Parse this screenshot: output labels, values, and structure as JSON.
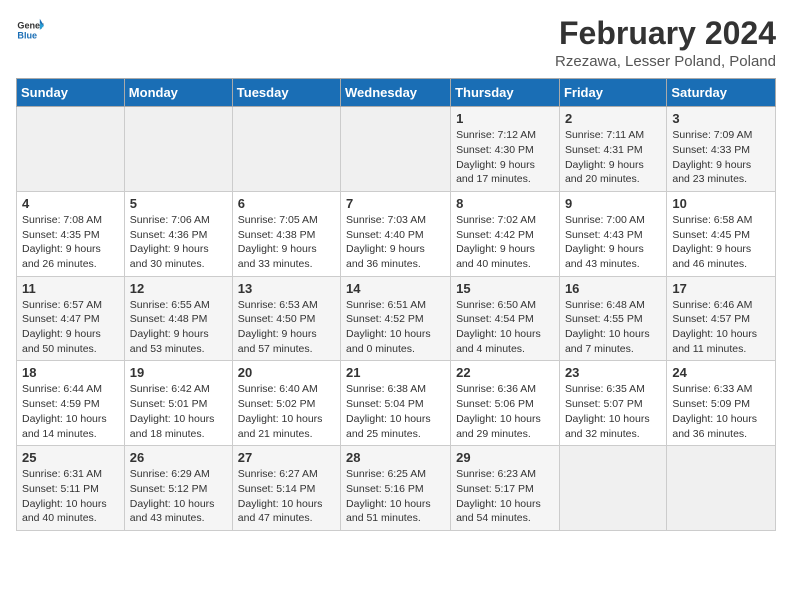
{
  "header": {
    "logo_line1": "General",
    "logo_line2": "Blue",
    "month_title": "February 2024",
    "location": "Rzezawa, Lesser Poland, Poland"
  },
  "weekdays": [
    "Sunday",
    "Monday",
    "Tuesday",
    "Wednesday",
    "Thursday",
    "Friday",
    "Saturday"
  ],
  "weeks": [
    [
      {
        "day": "",
        "info": ""
      },
      {
        "day": "",
        "info": ""
      },
      {
        "day": "",
        "info": ""
      },
      {
        "day": "",
        "info": ""
      },
      {
        "day": "1",
        "info": "Sunrise: 7:12 AM\nSunset: 4:30 PM\nDaylight: 9 hours\nand 17 minutes."
      },
      {
        "day": "2",
        "info": "Sunrise: 7:11 AM\nSunset: 4:31 PM\nDaylight: 9 hours\nand 20 minutes."
      },
      {
        "day": "3",
        "info": "Sunrise: 7:09 AM\nSunset: 4:33 PM\nDaylight: 9 hours\nand 23 minutes."
      }
    ],
    [
      {
        "day": "4",
        "info": "Sunrise: 7:08 AM\nSunset: 4:35 PM\nDaylight: 9 hours\nand 26 minutes."
      },
      {
        "day": "5",
        "info": "Sunrise: 7:06 AM\nSunset: 4:36 PM\nDaylight: 9 hours\nand 30 minutes."
      },
      {
        "day": "6",
        "info": "Sunrise: 7:05 AM\nSunset: 4:38 PM\nDaylight: 9 hours\nand 33 minutes."
      },
      {
        "day": "7",
        "info": "Sunrise: 7:03 AM\nSunset: 4:40 PM\nDaylight: 9 hours\nand 36 minutes."
      },
      {
        "day": "8",
        "info": "Sunrise: 7:02 AM\nSunset: 4:42 PM\nDaylight: 9 hours\nand 40 minutes."
      },
      {
        "day": "9",
        "info": "Sunrise: 7:00 AM\nSunset: 4:43 PM\nDaylight: 9 hours\nand 43 minutes."
      },
      {
        "day": "10",
        "info": "Sunrise: 6:58 AM\nSunset: 4:45 PM\nDaylight: 9 hours\nand 46 minutes."
      }
    ],
    [
      {
        "day": "11",
        "info": "Sunrise: 6:57 AM\nSunset: 4:47 PM\nDaylight: 9 hours\nand 50 minutes."
      },
      {
        "day": "12",
        "info": "Sunrise: 6:55 AM\nSunset: 4:48 PM\nDaylight: 9 hours\nand 53 minutes."
      },
      {
        "day": "13",
        "info": "Sunrise: 6:53 AM\nSunset: 4:50 PM\nDaylight: 9 hours\nand 57 minutes."
      },
      {
        "day": "14",
        "info": "Sunrise: 6:51 AM\nSunset: 4:52 PM\nDaylight: 10 hours\nand 0 minutes."
      },
      {
        "day": "15",
        "info": "Sunrise: 6:50 AM\nSunset: 4:54 PM\nDaylight: 10 hours\nand 4 minutes."
      },
      {
        "day": "16",
        "info": "Sunrise: 6:48 AM\nSunset: 4:55 PM\nDaylight: 10 hours\nand 7 minutes."
      },
      {
        "day": "17",
        "info": "Sunrise: 6:46 AM\nSunset: 4:57 PM\nDaylight: 10 hours\nand 11 minutes."
      }
    ],
    [
      {
        "day": "18",
        "info": "Sunrise: 6:44 AM\nSunset: 4:59 PM\nDaylight: 10 hours\nand 14 minutes."
      },
      {
        "day": "19",
        "info": "Sunrise: 6:42 AM\nSunset: 5:01 PM\nDaylight: 10 hours\nand 18 minutes."
      },
      {
        "day": "20",
        "info": "Sunrise: 6:40 AM\nSunset: 5:02 PM\nDaylight: 10 hours\nand 21 minutes."
      },
      {
        "day": "21",
        "info": "Sunrise: 6:38 AM\nSunset: 5:04 PM\nDaylight: 10 hours\nand 25 minutes."
      },
      {
        "day": "22",
        "info": "Sunrise: 6:36 AM\nSunset: 5:06 PM\nDaylight: 10 hours\nand 29 minutes."
      },
      {
        "day": "23",
        "info": "Sunrise: 6:35 AM\nSunset: 5:07 PM\nDaylight: 10 hours\nand 32 minutes."
      },
      {
        "day": "24",
        "info": "Sunrise: 6:33 AM\nSunset: 5:09 PM\nDaylight: 10 hours\nand 36 minutes."
      }
    ],
    [
      {
        "day": "25",
        "info": "Sunrise: 6:31 AM\nSunset: 5:11 PM\nDaylight: 10 hours\nand 40 minutes."
      },
      {
        "day": "26",
        "info": "Sunrise: 6:29 AM\nSunset: 5:12 PM\nDaylight: 10 hours\nand 43 minutes."
      },
      {
        "day": "27",
        "info": "Sunrise: 6:27 AM\nSunset: 5:14 PM\nDaylight: 10 hours\nand 47 minutes."
      },
      {
        "day": "28",
        "info": "Sunrise: 6:25 AM\nSunset: 5:16 PM\nDaylight: 10 hours\nand 51 minutes."
      },
      {
        "day": "29",
        "info": "Sunrise: 6:23 AM\nSunset: 5:17 PM\nDaylight: 10 hours\nand 54 minutes."
      },
      {
        "day": "",
        "info": ""
      },
      {
        "day": "",
        "info": ""
      }
    ]
  ]
}
